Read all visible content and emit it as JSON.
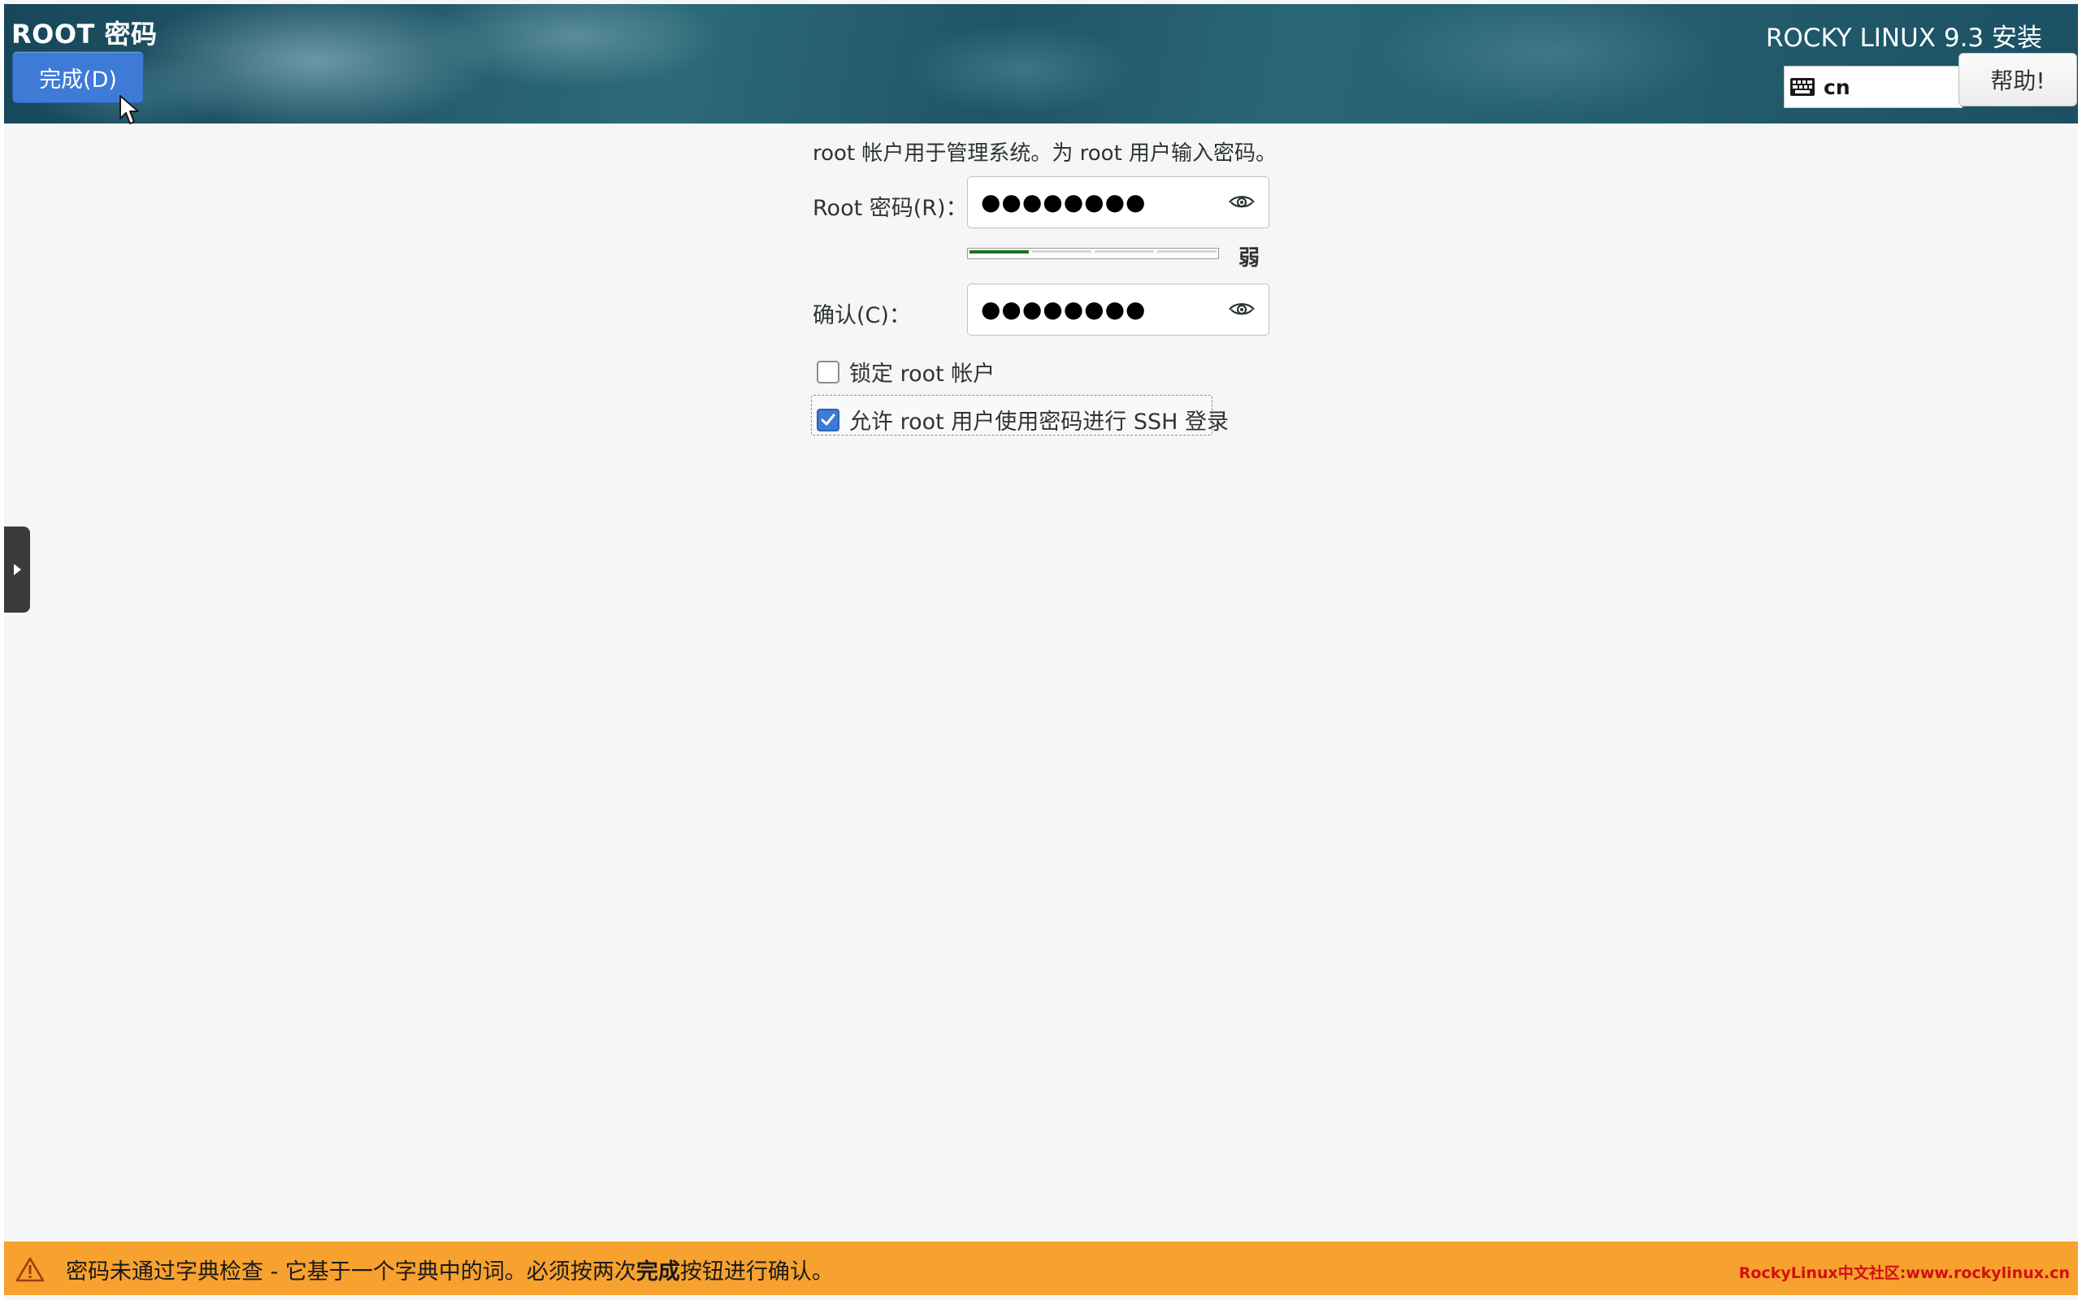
{
  "header": {
    "title": "ROOT 密码",
    "done_label": "完成(D)",
    "product_title": "ROCKY LINUX 9.3 安装",
    "keyboard_layout": "cn",
    "help_label": "帮助!"
  },
  "form": {
    "intro": "root 帐户用于管理系统。为 root 用户输入密码。",
    "password_label": "Root 密码(R)：",
    "password_value": "●●●●●●●●",
    "strength": {
      "level": 1,
      "segments": 4,
      "label": "弱",
      "color": "#1f6f21"
    },
    "confirm_label": "确认(C)：",
    "confirm_value": "●●●●●●●●",
    "lock_root": {
      "label": "锁定 root 帐户",
      "checked": false
    },
    "allow_ssh": {
      "label": "允许 root 用户使用密码进行 SSH 登录",
      "checked": true
    }
  },
  "warning": {
    "text_before": "密码未通过字典检查 - 它基于一个字典中的词。必须按两次",
    "text_bold": "完成",
    "text_after": "按钮进行确认。",
    "watermark": "RockyLinux中文社区:www.rockylinux.cn"
  },
  "colors": {
    "accent": "#3d7bd6",
    "warning": "#f7a12f",
    "watermark": "#d10f0f"
  }
}
